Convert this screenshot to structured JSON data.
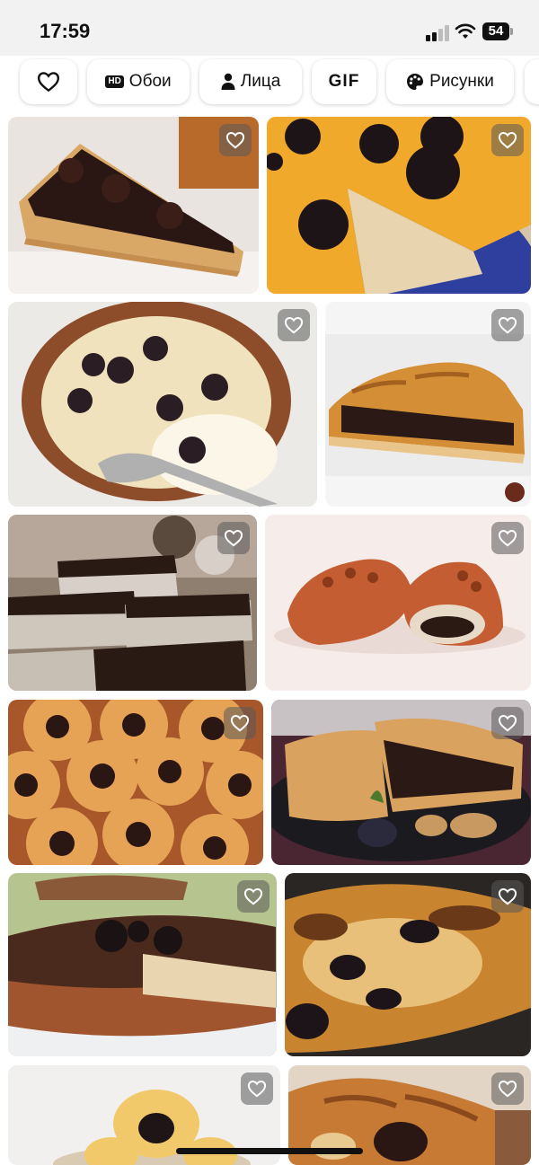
{
  "status_bar": {
    "time": "17:59",
    "battery": "54"
  },
  "chips": [
    {
      "id": "favorites",
      "label": "",
      "icon": "heart-icon"
    },
    {
      "id": "wallpapers",
      "badge": "HD",
      "label": "Обои"
    },
    {
      "id": "faces",
      "label": "Лица",
      "icon": "person-icon"
    },
    {
      "id": "gif",
      "label": "GIF"
    },
    {
      "id": "drawings",
      "label": "Рисунки",
      "icon": "palette-icon"
    }
  ],
  "images": [
    {
      "desc": "tart slice with prunes"
    },
    {
      "desc": "pumpkin pie with prunes on blue plate"
    },
    {
      "desc": "clafoutis with prunes in dish"
    },
    {
      "desc": "closed pie slice with prune filling"
    },
    {
      "desc": "chocolate bars with prunes"
    },
    {
      "desc": "two stuffed buns with nuts"
    },
    {
      "desc": "rolled buns with prunes"
    },
    {
      "desc": "pie with prunes and walnuts"
    },
    {
      "desc": "cake with prunes and chocolate"
    },
    {
      "desc": "baked pudding with prunes"
    },
    {
      "desc": "cookies with prunes"
    },
    {
      "desc": "braided pastry with prunes"
    }
  ],
  "colors": {
    "status_bg": "#f2f2f2",
    "fav_bg": "rgba(90,90,90,0.55)"
  }
}
